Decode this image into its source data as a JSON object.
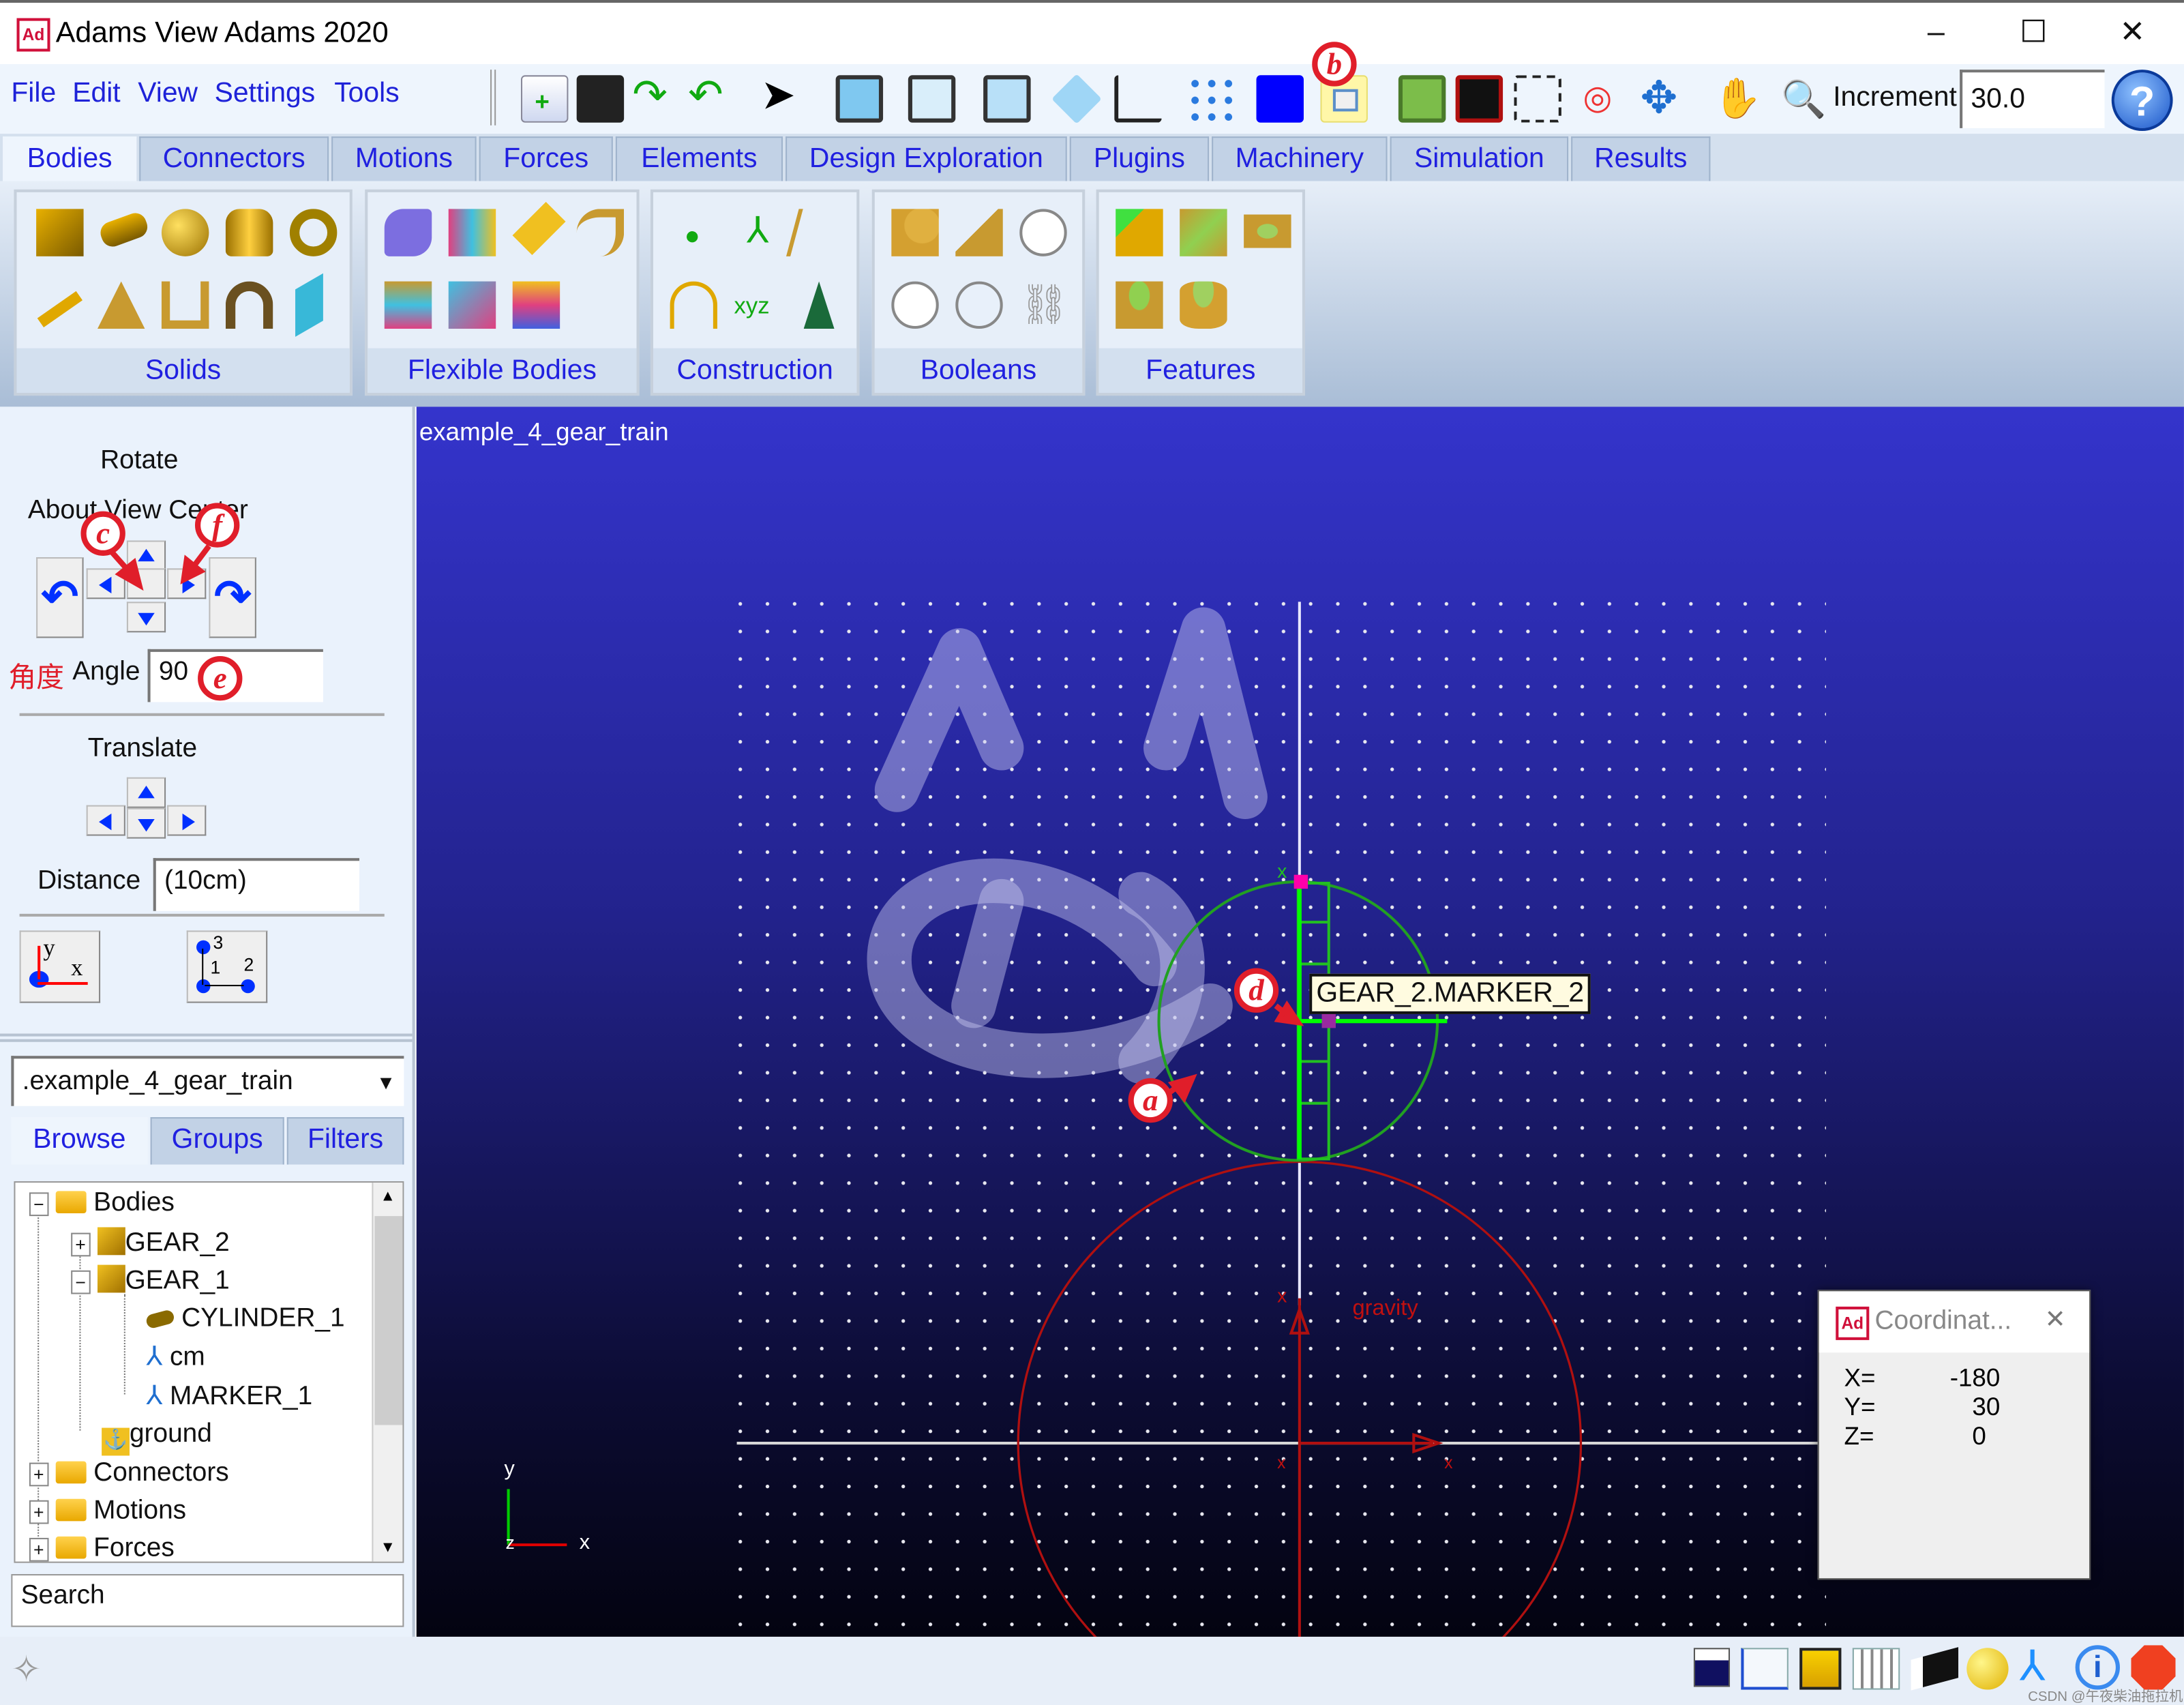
{
  "window": {
    "title": "Adams View Adams 2020",
    "logo": "Ad",
    "minimize": "–",
    "maximize": "☐",
    "close": "✕"
  },
  "menu": [
    "File",
    "Edit",
    "View",
    "Settings",
    "Tools"
  ],
  "toolbar": {
    "icons": [
      "new-model-icon",
      "save-icon",
      "redo-icon",
      "undo-icon",
      "select-arrow-icon",
      "front-view-icon",
      "top-view-icon",
      "right-view-icon",
      "iso-view-icon",
      "working-grid-icon",
      "toggle-icons-icon",
      "color-icon",
      "view-orientation-icon",
      "fit-icon",
      "zoom-box-icon",
      "zoom-window-icon",
      "view-center-icon",
      "rotate-icon",
      "pan-hand-icon",
      "zoom-icon"
    ],
    "increment_label": "Increment",
    "increment_value": "30.0",
    "help": "?"
  },
  "tabs": [
    "Bodies",
    "Connectors",
    "Motions",
    "Forces",
    "Elements",
    "Design Exploration",
    "Plugins",
    "Machinery",
    "Simulation",
    "Results"
  ],
  "active_tab": "Bodies",
  "ribbon_groups": [
    {
      "label": "Solids",
      "icons": [
        "box",
        "cylinder",
        "sphere",
        "frustum",
        "torus",
        "link",
        "plate",
        "extrusion",
        "revolution",
        "plane"
      ]
    },
    {
      "label": "Flexible Bodies",
      "icons": [
        "viewflex",
        "flex-swap",
        "discrete-flex",
        "flex-beam",
        "flex-import",
        "flex-convert",
        "flex-color"
      ]
    },
    {
      "label": "Construction",
      "icons": [
        "point",
        "marker",
        "polyline",
        "arc",
        "spline-xyz",
        "dummy"
      ]
    },
    {
      "label": "Booleans",
      "icons": [
        "unite",
        "merge",
        "intersect",
        "cut",
        "split",
        "chain"
      ]
    },
    {
      "label": "Features",
      "icons": [
        "chamfer",
        "fillet",
        "hole",
        "boss",
        "hollow"
      ]
    }
  ],
  "left_panel": {
    "rotate_title": "Rotate",
    "rotate_sub": "About View Center",
    "angle_label_cn": "角度",
    "angle_label": "Angle",
    "angle_value": "90",
    "translate_title": "Translate",
    "distance_label": "Distance",
    "distance_value": "(10cm)",
    "triad_y": "y",
    "triad_x": "x",
    "screen_1": "1",
    "screen_2": "2",
    "screen_3": "3"
  },
  "browser": {
    "model_select": ".example_4_gear_train",
    "tabs": [
      "Browse",
      "Groups",
      "Filters"
    ],
    "tree": [
      {
        "label": "Bodies",
        "sign": "−"
      },
      {
        "label": "GEAR_2",
        "sign": "+"
      },
      {
        "label": "GEAR_1",
        "sign": "−"
      },
      {
        "label": "CYLINDER_1"
      },
      {
        "label": "cm"
      },
      {
        "label": "MARKER_1"
      },
      {
        "label": "ground"
      },
      {
        "label": "Connectors",
        "sign": "+"
      },
      {
        "label": "Motions",
        "sign": "+"
      },
      {
        "label": "Forces",
        "sign": "+"
      }
    ],
    "search": "Search"
  },
  "viewport": {
    "model_name": "example_4_gear_train",
    "tooltip": "GEAR_2.MARKER_2",
    "gravity_label": "gravity",
    "axis_y": "y",
    "axis_x": "x",
    "axis_z": "z",
    "colors": {
      "gear": "#22c022",
      "selected": "#00ff00",
      "ground": "#b01010",
      "grid": "#ffffff"
    }
  },
  "coord_window": {
    "title": "Coordinat...",
    "logo": "Ad",
    "close": "✕",
    "x_label": "X=",
    "x": "-180",
    "y_label": "Y=",
    "y": "30",
    "z_label": "Z=",
    "z": "0"
  },
  "annotations": [
    "a",
    "b",
    "c",
    "d",
    "e",
    "f"
  ],
  "status_icons": [
    "background-color-icon",
    "plot-icon",
    "render-icon",
    "table-icon",
    "shaded-box-icon",
    "sphere-icon",
    "triad-icon",
    "info-icon",
    "stop-icon"
  ],
  "watermark": "CSDN @午夜柴油拖拉机"
}
